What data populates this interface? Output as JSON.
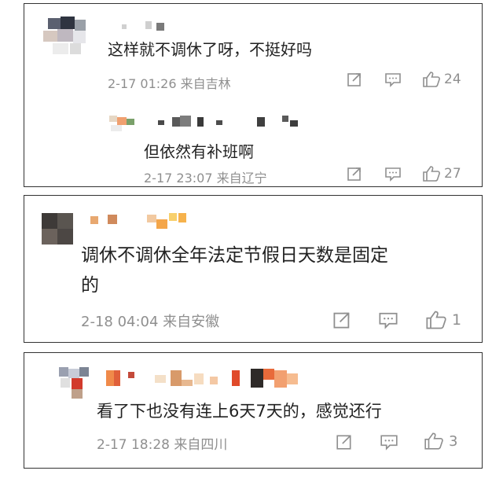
{
  "comments": [
    {
      "text": "这样就不调休了呀，不挺好吗",
      "meta": "2-17 01:26 来自吉林",
      "likes": "24",
      "reply": {
        "text": "但依然有补班啊",
        "meta": "2-17 23:07 来自辽宁",
        "likes": "27"
      }
    },
    {
      "text_line1": "调休不调休全年法定节假日天数是固定",
      "text_line2": "的",
      "meta": "2-18 04:04 来自安徽",
      "likes": "1"
    },
    {
      "text": "看了下也没有连上6天7天的，感觉还行",
      "meta": "2-17 18:28 来自四川",
      "likes": "3"
    }
  ],
  "icons": [
    "share-icon",
    "comment-icon",
    "like-icon"
  ],
  "colors": {
    "meta": "#8f8f8f",
    "border": "#333333",
    "text": "#222222"
  }
}
